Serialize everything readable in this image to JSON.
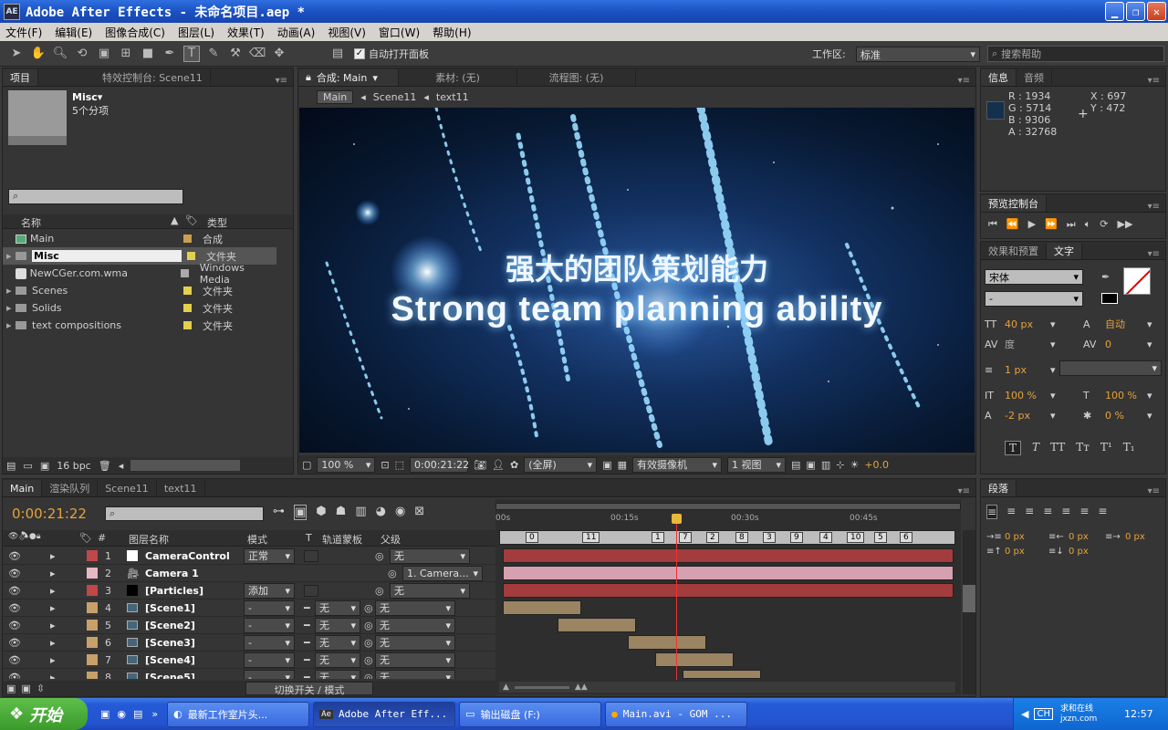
{
  "window": {
    "title": "Adobe After Effects - 未命名项目.aep *",
    "logo": "AE"
  },
  "menu": [
    "文件(F)",
    "编辑(E)",
    "图像合成(C)",
    "图层(L)",
    "效果(T)",
    "动画(A)",
    "视图(V)",
    "窗口(W)",
    "帮助(H)"
  ],
  "toolbar": {
    "auto_open": "自动打开面板",
    "workspace_label": "工作区:",
    "workspace_value": "标准",
    "search_help": "搜索帮助"
  },
  "project": {
    "tabs": [
      "项目",
      "特效控制台: Scene11"
    ],
    "selected_name": "Misc▾",
    "selected_info": "5个分项",
    "col_name": "名称",
    "col_type": "类型",
    "bpc": "16 bpc",
    "items": [
      {
        "name": "Main",
        "type": "合成",
        "icon": "comp-icon"
      },
      {
        "name": "Misc",
        "type": "文件夹",
        "icon": "folder-icon"
      },
      {
        "name": "NewCGer.com.wma",
        "type": "Windows Media",
        "icon": "audio-icon"
      },
      {
        "name": "Scenes",
        "type": "文件夹",
        "icon": "folder-icon"
      },
      {
        "name": "Solids",
        "type": "文件夹",
        "icon": "folder-icon"
      },
      {
        "name": "text compositions",
        "type": "文件夹",
        "icon": "folder-icon"
      }
    ]
  },
  "comp": {
    "tabs": [
      "合成: Main",
      "素材: (无)",
      "流程图: (无)"
    ],
    "breadcrumbs": [
      "Main",
      "Scene11",
      "text11"
    ],
    "title_cn": "强大的团队策划能力",
    "title_en": "Strong team planning ability",
    "zoom": "100 %",
    "timecode": "0:00:21:22",
    "resolution": "(全屏)",
    "camera": "有效摄像机",
    "views": "1 视图",
    "offset": "+0.0"
  },
  "info": {
    "tabs": [
      "信息",
      "音频"
    ],
    "r": "R : 1934",
    "g": "G : 5714",
    "b": "B : 9306",
    "a": "A : 32768",
    "x": "X : 697",
    "y": "Y : 472"
  },
  "preview": {
    "tab": "预览控制台"
  },
  "text": {
    "tabs": [
      "效果和预置",
      "文字"
    ],
    "font": "宋体",
    "style": "-",
    "size": "40 px",
    "leading": "自动",
    "kerning": "度",
    "tracking": "0",
    "stroke": "1 px",
    "vscale": "100 %",
    "hscale": "100 %",
    "baseline": "-2 px",
    "tsume": "0 %"
  },
  "paragraph": {
    "tab": "段落",
    "values": [
      "0 px",
      "0 px",
      "0 px",
      "0 px",
      "0 px"
    ]
  },
  "timeline": {
    "tabs": [
      "Main",
      "渲染队列",
      "Scene11",
      "text11"
    ],
    "timecode": "0:00:21:22",
    "cols": {
      "name": "图层名称",
      "mode": "模式",
      "t": "T",
      "track": "轨道蒙板",
      "parent": "父级",
      "num": "#"
    },
    "ruler": [
      "00s",
      "00:15s",
      "00:30s",
      "00:45s"
    ],
    "markers": [
      "0",
      "11",
      "1",
      "7",
      "2",
      "8",
      "3",
      "9",
      "4",
      "10",
      "5",
      "6"
    ],
    "toggle_label": "切换开关 / 模式",
    "layers": [
      {
        "num": "1",
        "name": "CameraControl",
        "mode": "正常",
        "track": "",
        "parent": "无",
        "color": "#ffffff"
      },
      {
        "num": "2",
        "name": "Camera 1",
        "mode": "",
        "track": "",
        "parent": "1. Camera...",
        "color": "#e6b8c6"
      },
      {
        "num": "3",
        "name": "[Particles]",
        "mode": "添加",
        "track": "",
        "parent": "无",
        "color": "#000000"
      },
      {
        "num": "4",
        "name": "[Scene1]",
        "mode": "-",
        "track": "无",
        "parent": "无",
        "color": "#c8a06a"
      },
      {
        "num": "5",
        "name": "[Scene2]",
        "mode": "-",
        "track": "无",
        "parent": "无",
        "color": "#c8a06a"
      },
      {
        "num": "6",
        "name": "[Scene3]",
        "mode": "-",
        "track": "无",
        "parent": "无",
        "color": "#c8a06a"
      },
      {
        "num": "7",
        "name": "[Scene4]",
        "mode": "-",
        "track": "无",
        "parent": "无",
        "color": "#c8a06a"
      },
      {
        "num": "8",
        "name": "[Scene5]",
        "mode": "-",
        "track": "无",
        "parent": "无",
        "color": "#c8a06a"
      }
    ]
  },
  "taskbar": {
    "start": "开始",
    "tasks": [
      "最新工作室片头...",
      "Adobe After Eff...",
      "输出磁盘 (F:)",
      "Main.avi - GOM ..."
    ],
    "lang": "CH",
    "clock": "12:57",
    "watermark": "求和在线 jxzn.com"
  },
  "colors": {
    "accent": "#e6a23a",
    "titlebar": "#2458d0"
  }
}
